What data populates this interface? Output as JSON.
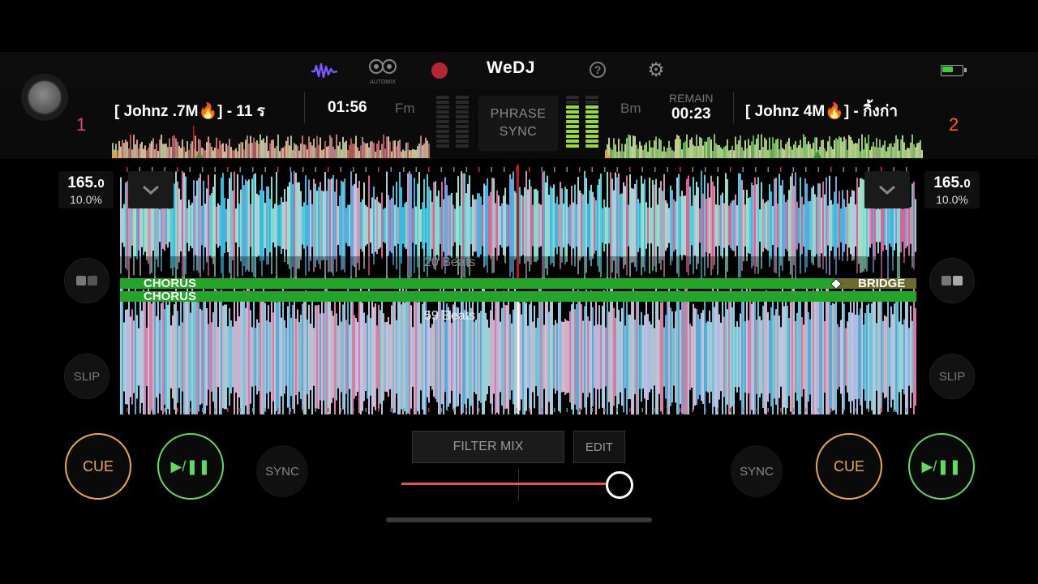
{
  "header": {
    "logo": "WeDJ",
    "automix_label": "AUTOMIX"
  },
  "deck1": {
    "number": "1",
    "title": "[ Johnz .7M🔥] - 11 ร",
    "time": "01:56",
    "key": "Fm",
    "bpm_int": "165.",
    "bpm_dec": "0",
    "pitch": "10.0%",
    "beats_label": "20 Beats",
    "sections": [
      "CHORUS",
      "BRIDGE"
    ],
    "cue_label": "CUE",
    "play_label": "▶/❚❚",
    "sync_label": "SYNC",
    "slip_label": "SLIP"
  },
  "deck2": {
    "number": "2",
    "title": "[ Johnz 4M🔥] - กิ้งก่า",
    "remain_label": "REMAIN",
    "remain_time": "00:23",
    "key": "Bm",
    "bpm_int": "165.",
    "bpm_dec": "0",
    "pitch": "10.0%",
    "beats_label": "59 Beats",
    "sections": [
      "CHORUS"
    ],
    "cue_label": "CUE",
    "play_label": "▶/❚❚",
    "sync_label": "SYNC",
    "slip_label": "SLIP"
  },
  "center": {
    "phrase_sync_line1": "PHRASE",
    "phrase_sync_line2": "SYNC",
    "filter_mix_label": "FILTER MIX",
    "edit_label": "EDIT",
    "crossfader_position": 0.94
  },
  "levels": {
    "deck1_meter": 0,
    "deck2_meter": 0.86
  },
  "colors": {
    "deck1_number": "#e0457a",
    "deck2_number": "#ff5a2a",
    "cue": "#e8a94a",
    "play": "#5fdc5f",
    "playhead": "#c0181b",
    "structure": "#22a528",
    "crossfader": "#e8583a",
    "waveform_icon": "#7a56ff"
  },
  "icons": [
    "waveform-icon",
    "automix-icon",
    "record-icon",
    "help-icon",
    "settings-icon",
    "battery-icon",
    "chevron-down-icon",
    "pad-mode-icon"
  ]
}
